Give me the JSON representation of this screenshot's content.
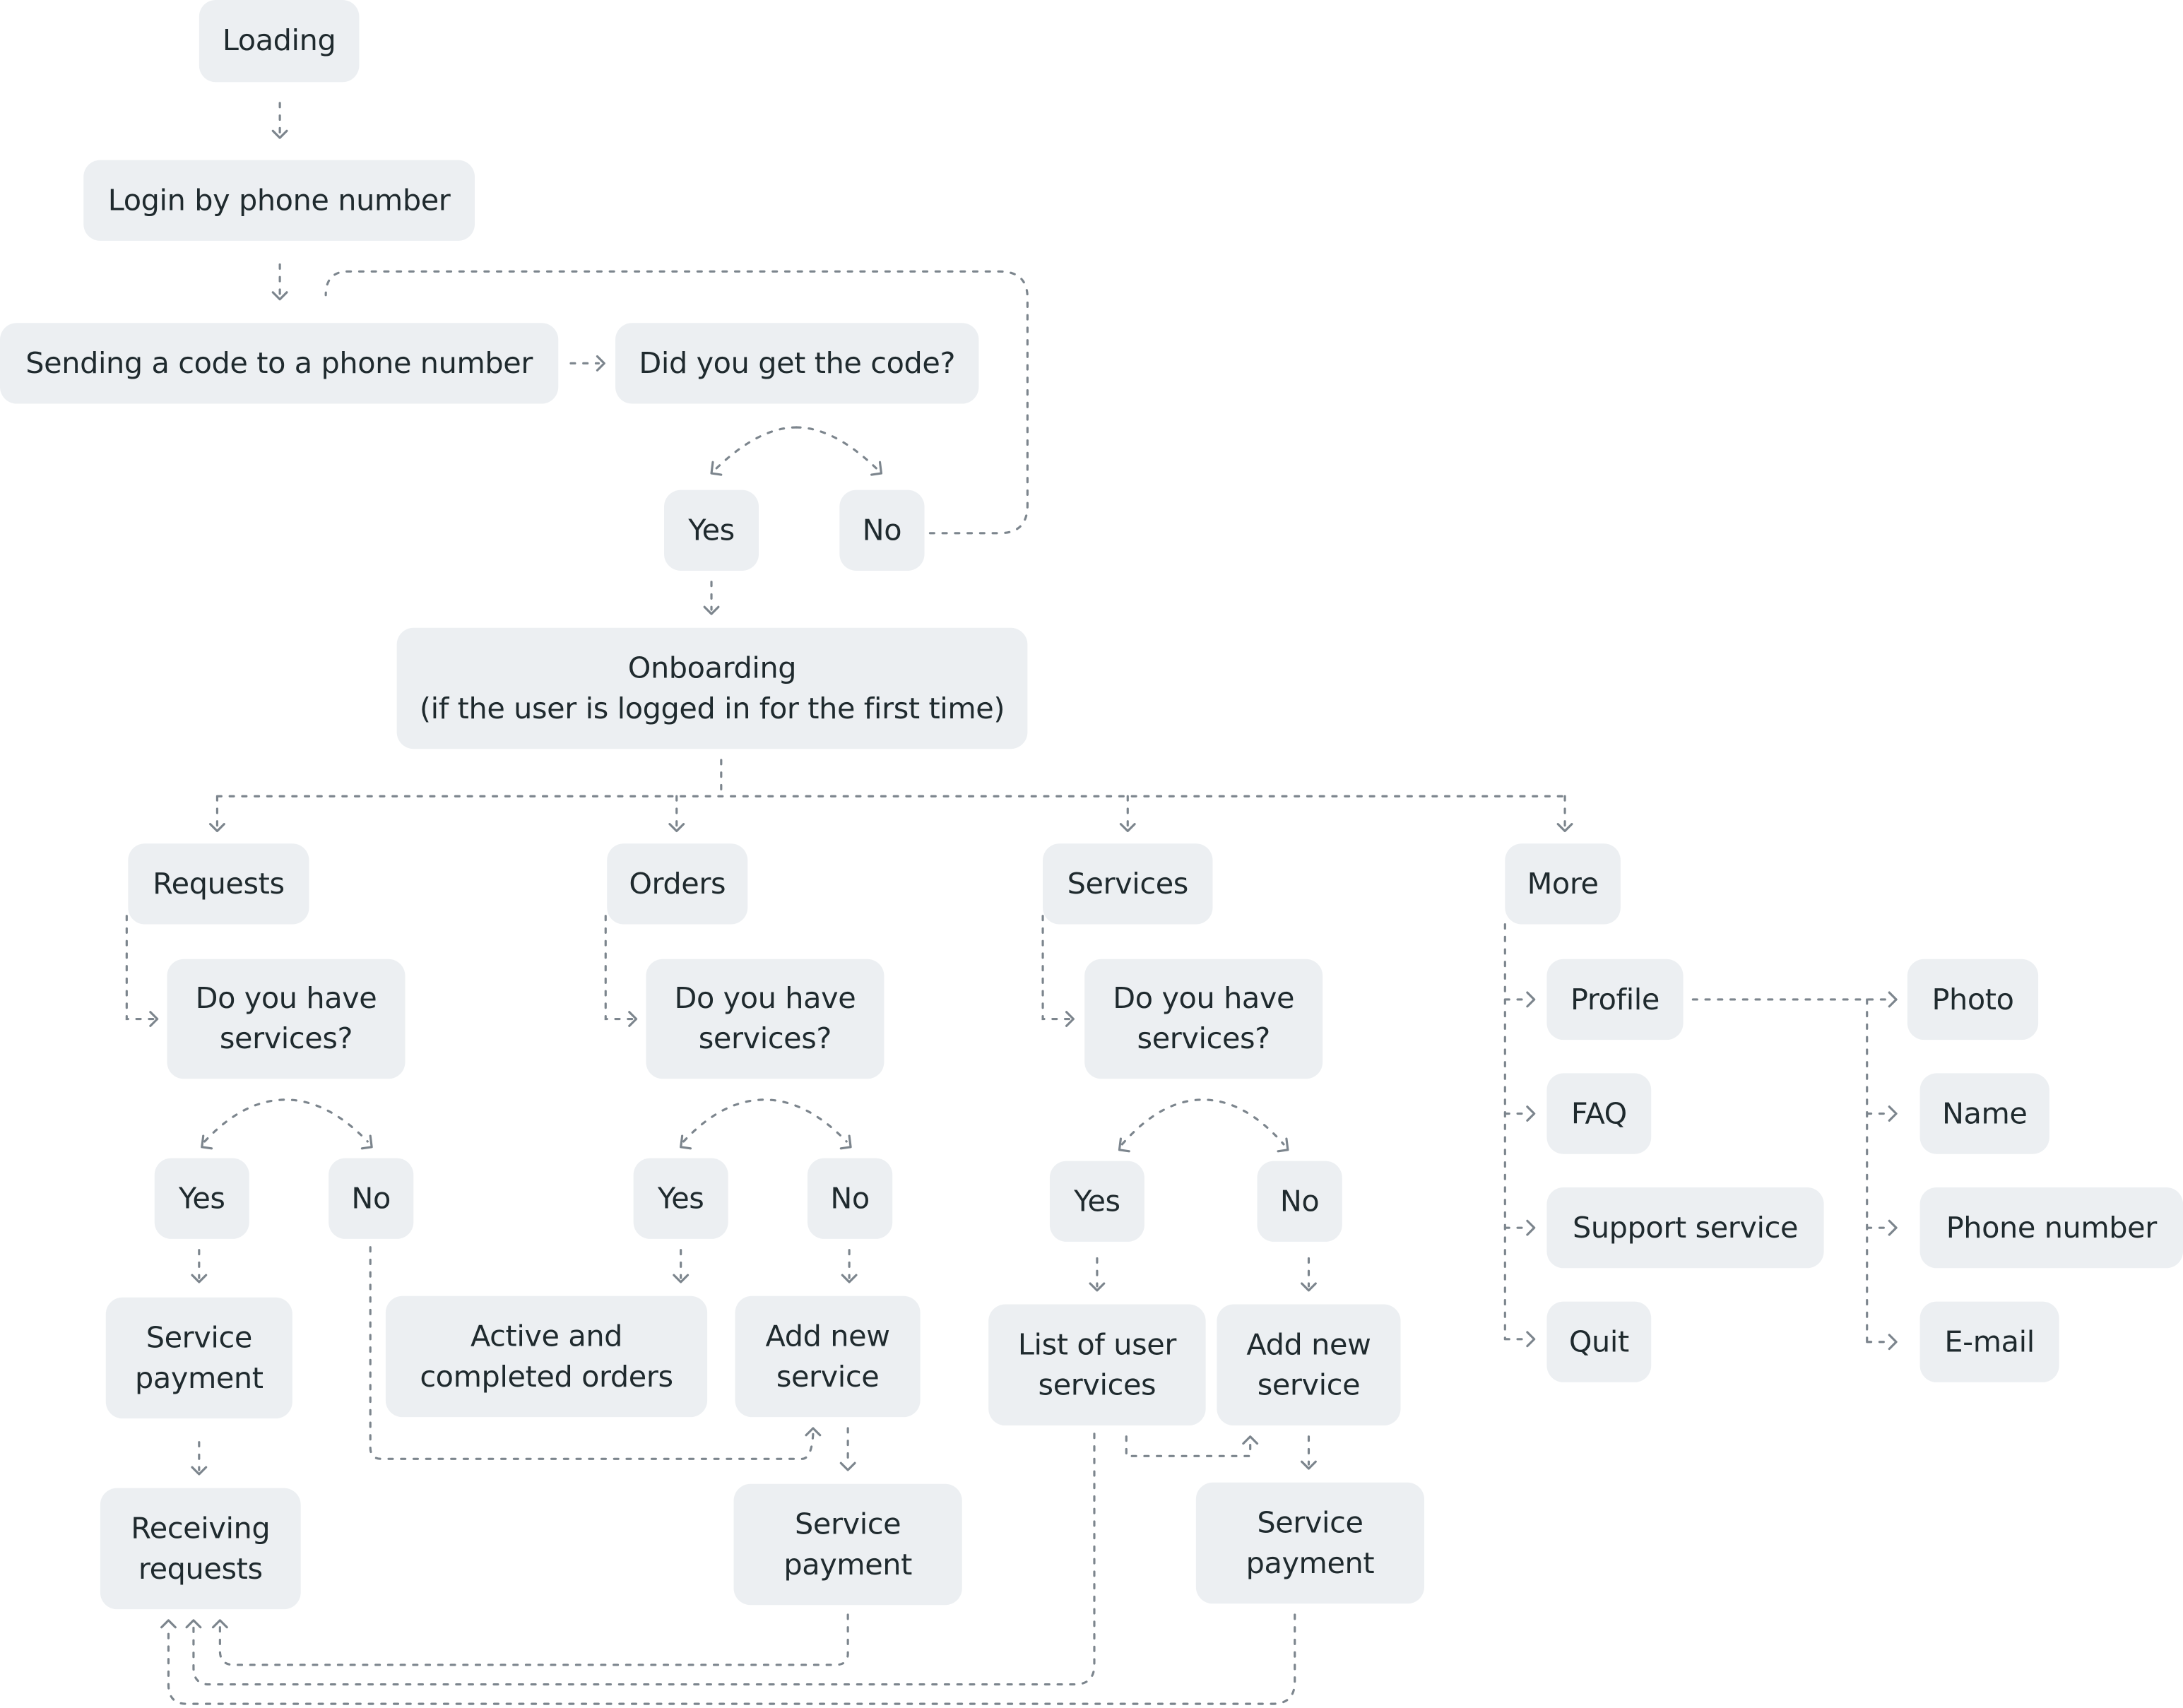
{
  "colors": {
    "node_fill": "#eceff2",
    "node_text": "#1f2a2e",
    "connector": "#7c858d",
    "background": "#ffffff"
  },
  "nodes": {
    "loading": "Loading",
    "login": "Login by phone number",
    "sending_code": "Sending a code to a phone number",
    "did_get_code": "Did you get the code?",
    "code_yes": "Yes",
    "code_no": "No",
    "onboarding": "Onboarding\n(if the user is logged in for the first time)",
    "requests": "Requests",
    "orders": "Orders",
    "services": "Services",
    "more": "More",
    "req_question": "Do you have\nservices?",
    "ord_question": "Do you have\nservices?",
    "srv_question": "Do you have\nservices?",
    "req_yes": "Yes",
    "req_no": "No",
    "ord_yes": "Yes",
    "ord_no": "No",
    "srv_yes": "Yes",
    "srv_no": "No",
    "req_service_payment": "Service\npayment",
    "receiving_requests": "Receiving\nrequests",
    "active_completed_orders": "Active and\ncompleted orders",
    "ord_add_new_service": "Add new\nservice",
    "ord_service_payment": "Service\npayment",
    "list_user_services": "List of user\nservices",
    "srv_add_new_service": "Add new\nservice",
    "srv_service_payment": "Service\npayment",
    "profile": "Profile",
    "faq": "FAQ",
    "support_service": "Support service",
    "quit": "Quit",
    "photo": "Photo",
    "name": "Name",
    "phone_number": "Phone number",
    "email": "E-mail"
  }
}
